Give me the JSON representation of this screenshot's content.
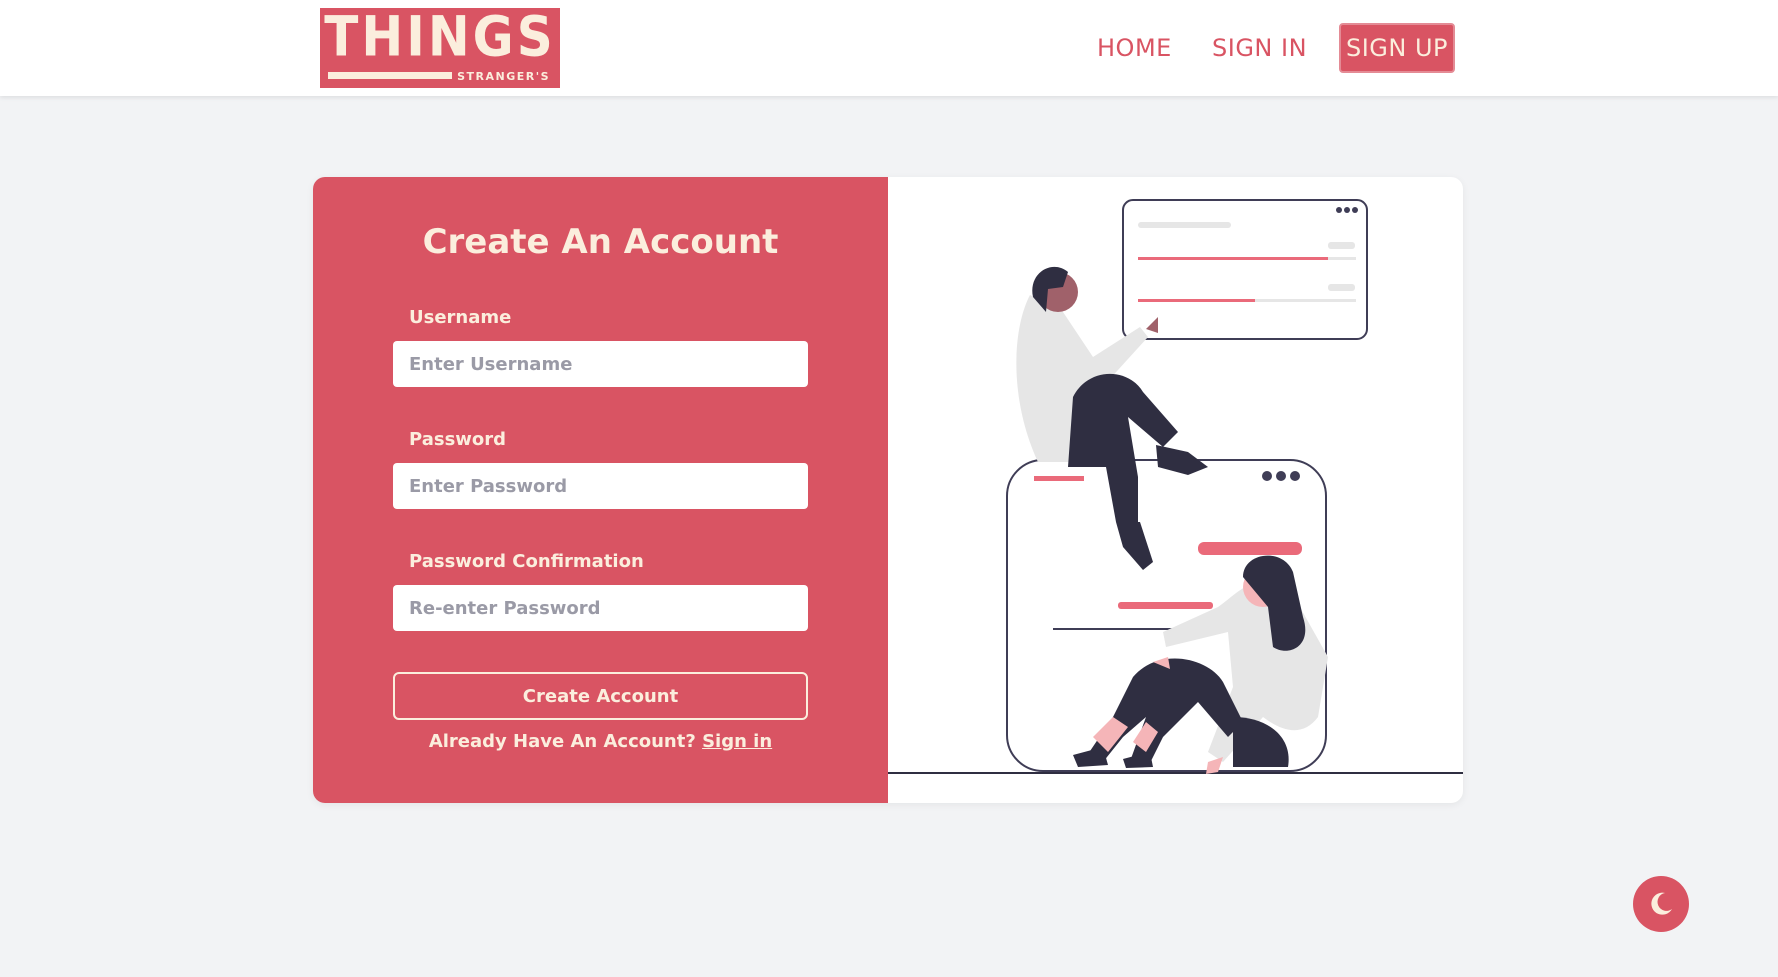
{
  "brand": {
    "name": "THINGS",
    "subtitle": "STRANGER'S",
    "color": "#d95463",
    "text_color": "#fbeedd"
  },
  "nav": {
    "home": "HOME",
    "signin": "SIGN IN",
    "signup": "SIGN UP"
  },
  "form": {
    "title": "Create An Account",
    "username_label": "Username",
    "username_placeholder": "Enter Username",
    "password_label": "Password",
    "password_placeholder": "Enter Password",
    "confirm_label": "Password Confirmation",
    "confirm_placeholder": "Re-enter Password",
    "submit_label": "Create Account",
    "already_text": "Already Have An Account?",
    "signin_link": "Sign in"
  },
  "theme_toggle": {
    "icon": "moon-icon"
  }
}
